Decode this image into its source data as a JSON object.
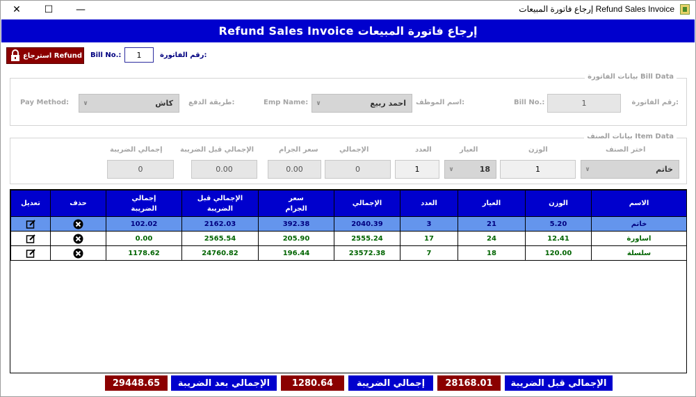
{
  "window": {
    "title": "إرجاع فاتورة المبيعات Refund Sales Invoice",
    "close_glyph": "✕",
    "max_glyph": "☐",
    "min_glyph": "—"
  },
  "header": {
    "title": "Refund Sales Invoice إرجاع فاتورة المبيعات"
  },
  "refund_bar": {
    "refund_button_label": "استرجاع Refund",
    "bill_no_label_en": "Bill No.:",
    "bill_no_value": "1",
    "bill_no_label_ar": "رقم الفاتورة:"
  },
  "bill_data": {
    "legend": "بيانات الفاتورة Bill Data",
    "bill_no_label_ar": "رقم الفاتورة:",
    "bill_no_value": "1",
    "bill_no_label_en": "Bill No.:",
    "emp_label_ar": "اسم الموظف:",
    "emp_value": "احمد ربيع",
    "emp_label_en": "Emp Name:",
    "pay_label_ar": "طريقة الدفع:",
    "pay_value": "كاش",
    "pay_label_en": "Pay Method:"
  },
  "item_data": {
    "legend": "بيانات الصنف Item Data",
    "choose_label": "اختر الصنف",
    "choose_value": "خاتم",
    "weight_label": "الوزن",
    "weight_value": "1",
    "karat_label": "العيار",
    "karat_value": "18",
    "count_label": "العدد",
    "count_value": "1",
    "total_label": "الإجمالي",
    "total_value": "0",
    "gram_price_label": "سعر الجرام",
    "gram_price_value": "0.00",
    "pre_tax_label": "الإجمالي قبل الضريبة",
    "pre_tax_value": "0.00",
    "tax_label": "إجمالي الضريبة",
    "tax_value": "0"
  },
  "grid": {
    "columns": [
      "الاسم",
      "الوزن",
      "العيار",
      "العدد",
      "الإجمالي",
      "سعر\nالجرام",
      "الإجمالي قبل\nالضريبة",
      "إجمالي\nالضريبة",
      "حذف",
      "تعديل"
    ],
    "rows": [
      [
        "خاتم",
        "5.20",
        "21",
        "3",
        "2040.39",
        "392.38",
        "2162.03",
        "102.02"
      ],
      [
        "اساورة",
        "12.41",
        "24",
        "17",
        "2555.24",
        "205.90",
        "2565.54",
        "0.00"
      ],
      [
        "سلسلة",
        "120.00",
        "18",
        "7",
        "23572.38",
        "196.44",
        "24760.82",
        "1178.62"
      ]
    ],
    "selected_row": 0
  },
  "footer": {
    "pre_tax_label": "الإجمالي قبل الضريبة",
    "pre_tax_value": "28168.01",
    "tax_label": "إجمالي الضريبة",
    "tax_value": "1280.64",
    "after_tax_label": "الإجمالي بعد الضريبة",
    "after_tax_value": "29448.65"
  },
  "colors": {
    "header_blue": "#0000cd",
    "refund_red": "#8b0000",
    "selected_row": "#6495ed",
    "row_text_green": "#006400"
  }
}
